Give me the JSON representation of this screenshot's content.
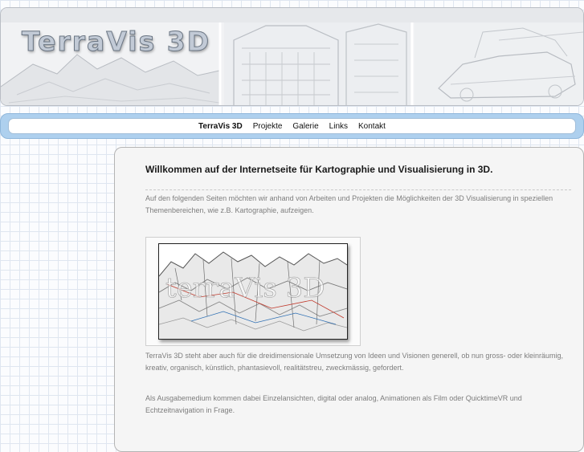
{
  "header": {
    "logo_text": "TerraVis 3D"
  },
  "nav": {
    "items": [
      {
        "label": "TerraVis 3D",
        "active": true
      },
      {
        "label": "Projekte",
        "active": false
      },
      {
        "label": "Galerie",
        "active": false
      },
      {
        "label": "Links",
        "active": false
      },
      {
        "label": "Kontakt",
        "active": false
      }
    ]
  },
  "main": {
    "heading": "Willkommen auf der Internetseite für Kartographie und Visualisierung in 3D.",
    "intro": "Auf den folgenden Seiten möchten wir anhand von Arbeiten und Projekten die Möglichkeiten der 3D Visualisierung in speziellen Themenbereichen, wie z.B. Kartographie, aufzeigen.",
    "image_watermark": "terraVis 3D",
    "paragraph2": "TerraVis 3D steht aber auch für die dreidimensionale Umsetzung von Ideen und Visionen generell, ob nun gross- oder kleinräumig, kreativ, organisch, künstlich, phantasievoll, realitätstreu, zweckmässig, gefordert.",
    "paragraph3": "Als Ausgabemedium kommen dabei Einzelansichten, digital oder analog, Animationen als Film oder QuicktimeVR und Echtzeitnavigation in Frage."
  },
  "colors": {
    "nav_bar": "#aed0ee",
    "grid_line": "#dfe6f0",
    "body_text": "#7d7d7d"
  }
}
